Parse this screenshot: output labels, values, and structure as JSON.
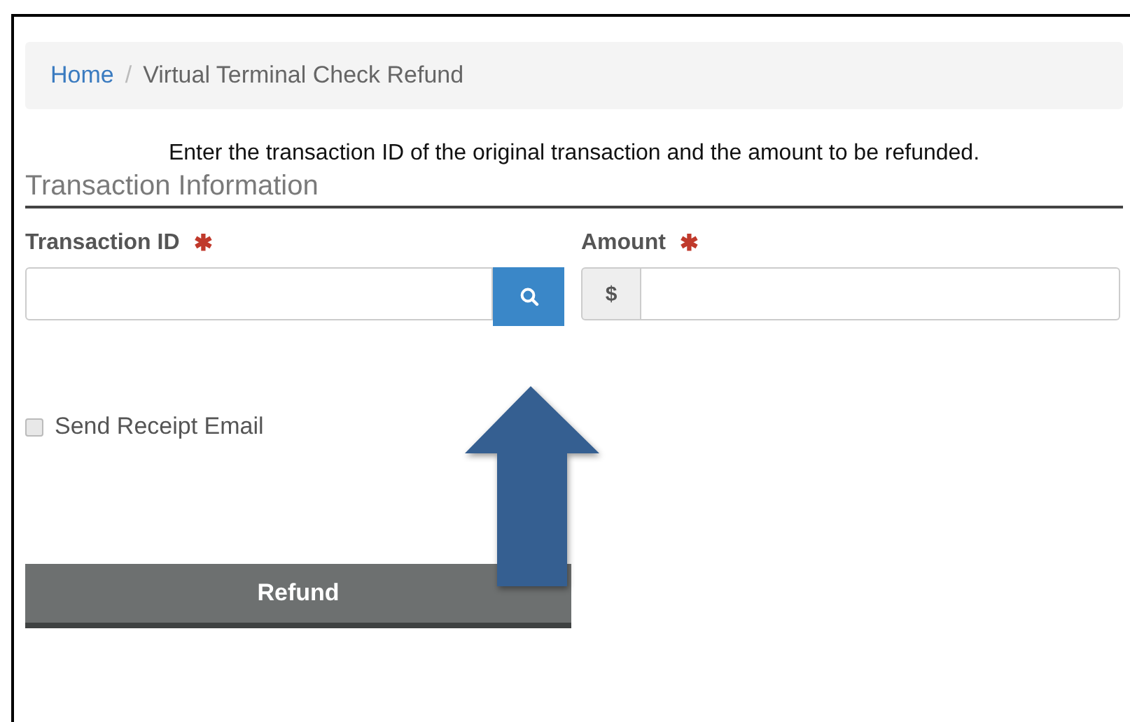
{
  "breadcrumb": [
    {
      "label": "Home",
      "kind": "link"
    },
    {
      "label": "Virtual Terminal Check Refund",
      "kind": "current"
    }
  ],
  "breadcrumb_separator": "/",
  "instructions": "Enter the transaction ID of the original transaction and the amount to be refunded.",
  "section_title": "Transaction Information",
  "fields": [
    {
      "label": "Transaction ID",
      "required_mark": "✱",
      "kind": "search"
    },
    {
      "label": "Amount",
      "required_mark": "✱",
      "kind": "currency",
      "prefix": "$"
    }
  ],
  "checkbox": {
    "label": "Send Receipt Email",
    "checked": false
  },
  "submit_button": "Refund"
}
